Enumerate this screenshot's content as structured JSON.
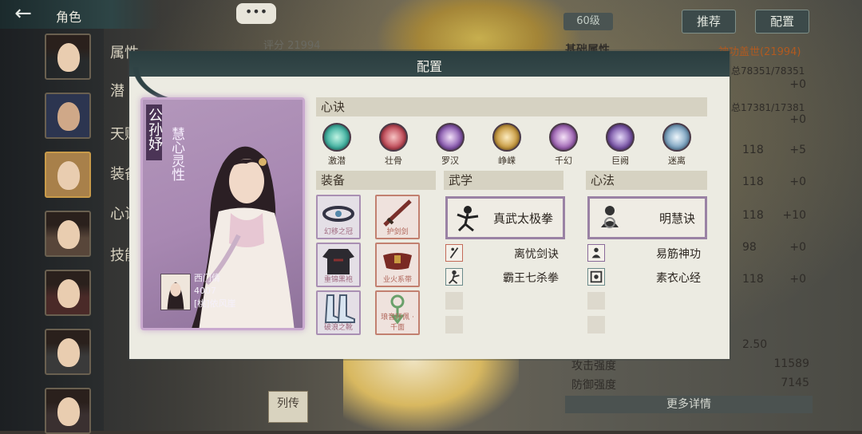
{
  "nav": {
    "back_icon": "back-arrow-icon",
    "title": "角色"
  },
  "left_menu": [
    "属性",
    "潜",
    "天赋",
    "装备",
    "心诀",
    "技能"
  ],
  "background": {
    "chat_label": "•••",
    "score": "评分  21994",
    "level": "60级",
    "recommend_label": "推荐",
    "config_label": "配置",
    "base_attr_label": "基础属性",
    "power_label": "神功盖世(21994)",
    "hp_text": "总78351/78351",
    "hp_delta": "+0",
    "mp_text": "总17381/17381",
    "mp_delta": "+0",
    "attr_rows": [
      {
        "value": "118",
        "delta": "+5"
      },
      {
        "value": "118",
        "delta": "+0"
      },
      {
        "value": "118",
        "delta": "+10"
      },
      {
        "value": "98",
        "delta": "+0"
      },
      {
        "value": "118",
        "delta": "+0"
      }
    ],
    "crit_value": "2.50",
    "attack_label": "攻击强度",
    "attack_value": "11589",
    "defense_label": "防御强度",
    "defense_value": "7145",
    "more_label": "更多详情",
    "scroll_label": "列传"
  },
  "modal": {
    "title": "配置",
    "character": {
      "name": "公孙妤",
      "trait": "慧心灵性",
      "partner_name": "西门倩",
      "partner_id": "4007",
      "partner_tag": "[桃]依风崖"
    },
    "xinjue_header": "心诀",
    "xinjue": [
      {
        "label": "激潜",
        "color": "#3fb0a0"
      },
      {
        "label": "壮骨",
        "color": "#c04a58"
      },
      {
        "label": "罗汉",
        "color": "#8a5ab0"
      },
      {
        "label": "峥嵘",
        "color": "#c89a40"
      },
      {
        "label": "千幻",
        "color": "#a065b5"
      },
      {
        "label": "巨阙",
        "color": "#7a55a8"
      },
      {
        "label": "迷离",
        "color": "#7aa2c0"
      }
    ],
    "equip_header": "装备",
    "equipment": [
      {
        "label": "幻移之冠"
      },
      {
        "label": "护剑剑"
      },
      {
        "label": "重锦黑袍"
      },
      {
        "label": "业火系带"
      },
      {
        "label": "破浪之靴"
      },
      {
        "label": "琅音环佩 · 千面"
      }
    ],
    "wuxue_header": "武学",
    "wuxue_main": "真武太极拳",
    "wuxue_subs": [
      "离忧剑诀",
      "霸王七杀拳"
    ],
    "xinfa_header": "心法",
    "xinfa_main": "明慧诀",
    "xinfa_subs": [
      "易筋神功",
      "素衣心经"
    ]
  }
}
